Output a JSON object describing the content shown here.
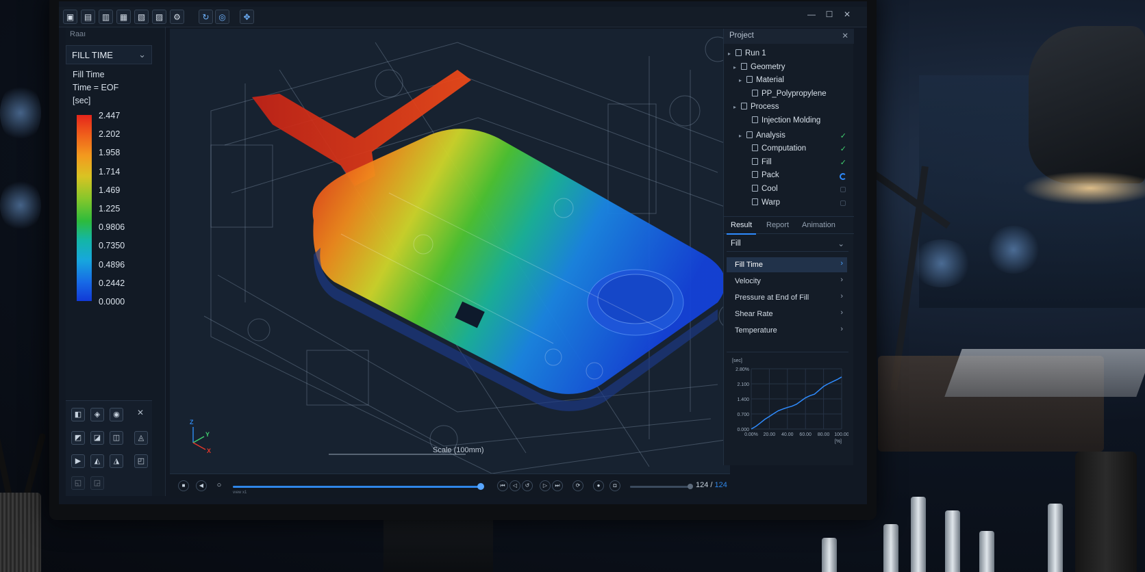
{
  "toolbar": {
    "icons": [
      "new-file",
      "open-file",
      "save-file",
      "import",
      "export",
      "mesh",
      "settings",
      "rotate",
      "orbit",
      "pan"
    ]
  },
  "left_panel": {
    "header": "Raaı",
    "result_select": "FILL TIME",
    "legend_title": "Fill Time",
    "legend_subtitle": "Time = EOF",
    "legend_unit": "[sec]",
    "legend_values": [
      "2.447",
      "2.202",
      "1.958",
      "1.714",
      "1.469",
      "1.225",
      "0.9806",
      "0.7350",
      "0.4896",
      "0.2442",
      "0.0000"
    ],
    "colors": {
      "max": "#e5251b",
      "mid": "#2dbb3c",
      "min": "#1139d6"
    }
  },
  "viewport": {
    "scale_label": "Scale (100mm)",
    "axes": {
      "z": "Z",
      "y": "Y",
      "x": "X"
    }
  },
  "project_panel": {
    "title": "Project",
    "tree": [
      {
        "label": "Run 1",
        "status": ""
      },
      {
        "label": "Geometry",
        "status": ""
      },
      {
        "label": "Material",
        "status": ""
      },
      {
        "label": "PP_Polypropylene",
        "status": ""
      },
      {
        "label": "Process",
        "status": ""
      },
      {
        "label": "Injection Molding",
        "status": ""
      },
      {
        "label": "Analysis",
        "status": "done"
      },
      {
        "label": "Computation",
        "status": "done"
      },
      {
        "label": "Fill",
        "status": "done"
      },
      {
        "label": "Pack",
        "status": "running"
      },
      {
        "label": "Cool",
        "status": "pending"
      },
      {
        "label": "Warp",
        "status": "pending"
      }
    ],
    "check_glyph": "✓",
    "tabs": [
      "Result",
      "Report",
      "Animation"
    ],
    "active_tab": "Result",
    "result_select": "Fill",
    "results": [
      "Fill Time",
      "Velocity",
      "Pressure at End of Fill",
      "Shear Rate",
      "Temperature"
    ],
    "active_result": "Fill Time"
  },
  "chart_data": {
    "type": "line",
    "ylabel": "[sec]",
    "xlabel": "[%]",
    "y_ticks": [
      "0.000",
      "0.700",
      "1.400",
      "2.100",
      "2.80%"
    ],
    "x_ticks": [
      "0.00%",
      "20.00",
      "40.00",
      "60.00",
      "80.00",
      "100.00"
    ],
    "xlim": [
      0,
      100
    ],
    "ylim": [
      0,
      2.8
    ],
    "x": [
      0,
      5,
      10,
      15,
      20,
      25,
      30,
      35,
      40,
      45,
      50,
      55,
      60,
      65,
      70,
      75,
      80,
      85,
      90,
      95,
      100
    ],
    "y": [
      0.0,
      0.12,
      0.28,
      0.45,
      0.58,
      0.72,
      0.85,
      0.93,
      1.0,
      1.06,
      1.15,
      1.3,
      1.45,
      1.55,
      1.62,
      1.8,
      1.98,
      2.1,
      2.2,
      2.3,
      2.42
    ],
    "line_color": "#2f8cff"
  },
  "bottom_bar": {
    "frame_current": "124",
    "frame_total": "124",
    "separator": " / ",
    "timeline_progress": 1.0,
    "speed_progress": 1.0,
    "small_caption": "vıew x1"
  }
}
